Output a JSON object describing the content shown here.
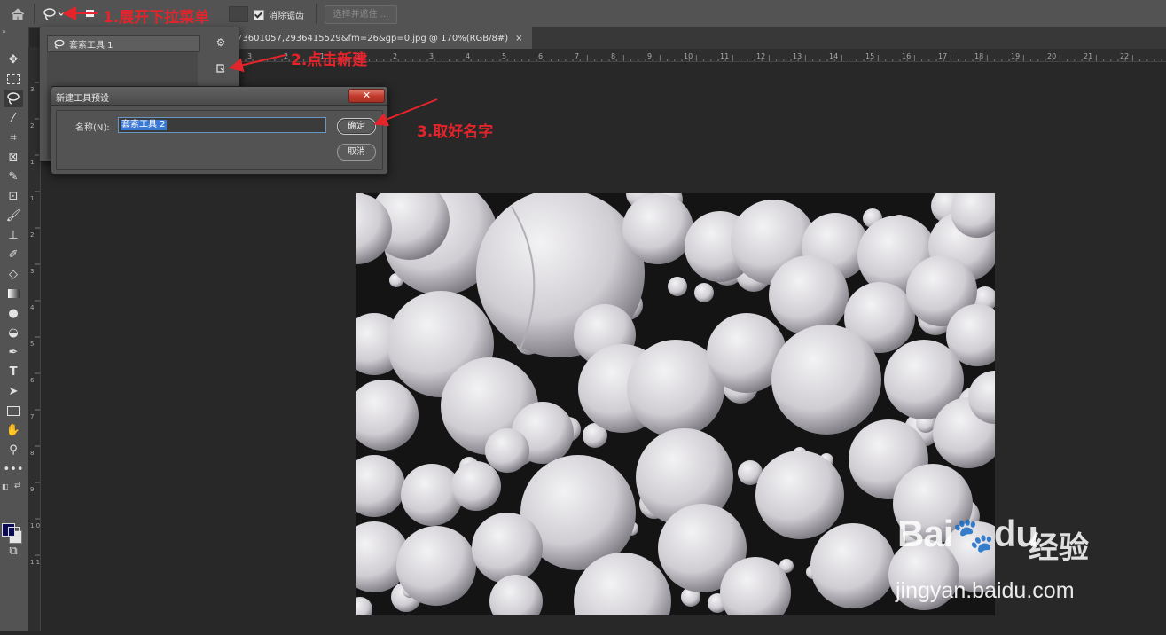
{
  "options_bar": {
    "anti_alias_label": "消除锯齿",
    "select_mask_label": "选择并遮住 ..."
  },
  "document_tab": {
    "title": "73601057,2936415529&fm=26&gp=0.jpg @ 170%(RGB/8#)",
    "close": "×"
  },
  "ruler": {
    "h_ticks": [
      "3",
      "2",
      "1",
      "1",
      "2",
      "3",
      "4",
      "5",
      "6",
      "7",
      "8",
      "9",
      "10",
      "11",
      "12",
      "13",
      "14",
      "15",
      "16",
      "17",
      "18",
      "19",
      "20",
      "21",
      "22"
    ],
    "v_ticks": [
      "3",
      "2",
      "1",
      "1",
      "2",
      "3",
      "4",
      "5",
      "6",
      "7",
      "8",
      "9",
      "1 0",
      "1 1"
    ]
  },
  "preset_panel": {
    "item_label": "套索工具 1"
  },
  "dialog": {
    "title": "新建工具预设",
    "close_glyph": "✕",
    "name_label": "名称(N):",
    "name_value": "套索工具 2",
    "ok_label": "确定",
    "cancel_label": "取消"
  },
  "annotations": {
    "step1": "1.展开下拉菜单",
    "step2": "2.点击新建",
    "step3": "3.取好名字",
    "color": "#e3242b"
  },
  "watermark": {
    "logo_text": "Bai",
    "logo_text2": "du",
    "cn_text": "经验",
    "url": "jingyan.baidu.com"
  },
  "colors": {
    "foreground": "#0b0a55",
    "background": "#e6e6e6"
  },
  "toolbar": {
    "tools": [
      "move-tool",
      "marquee-tool",
      "lasso-tool",
      "magic-wand-tool",
      "crop-tool",
      "frame-tool",
      "eyedropper-tool",
      "healing-tool",
      "brush-tool",
      "stamp-tool",
      "history-brush-tool",
      "eraser-tool",
      "gradient-tool",
      "blur-tool",
      "dodge-tool",
      "pen-tool",
      "type-tool",
      "path-select-tool",
      "rectangle-tool",
      "hand-tool",
      "zoom-tool",
      "more-tools"
    ]
  }
}
